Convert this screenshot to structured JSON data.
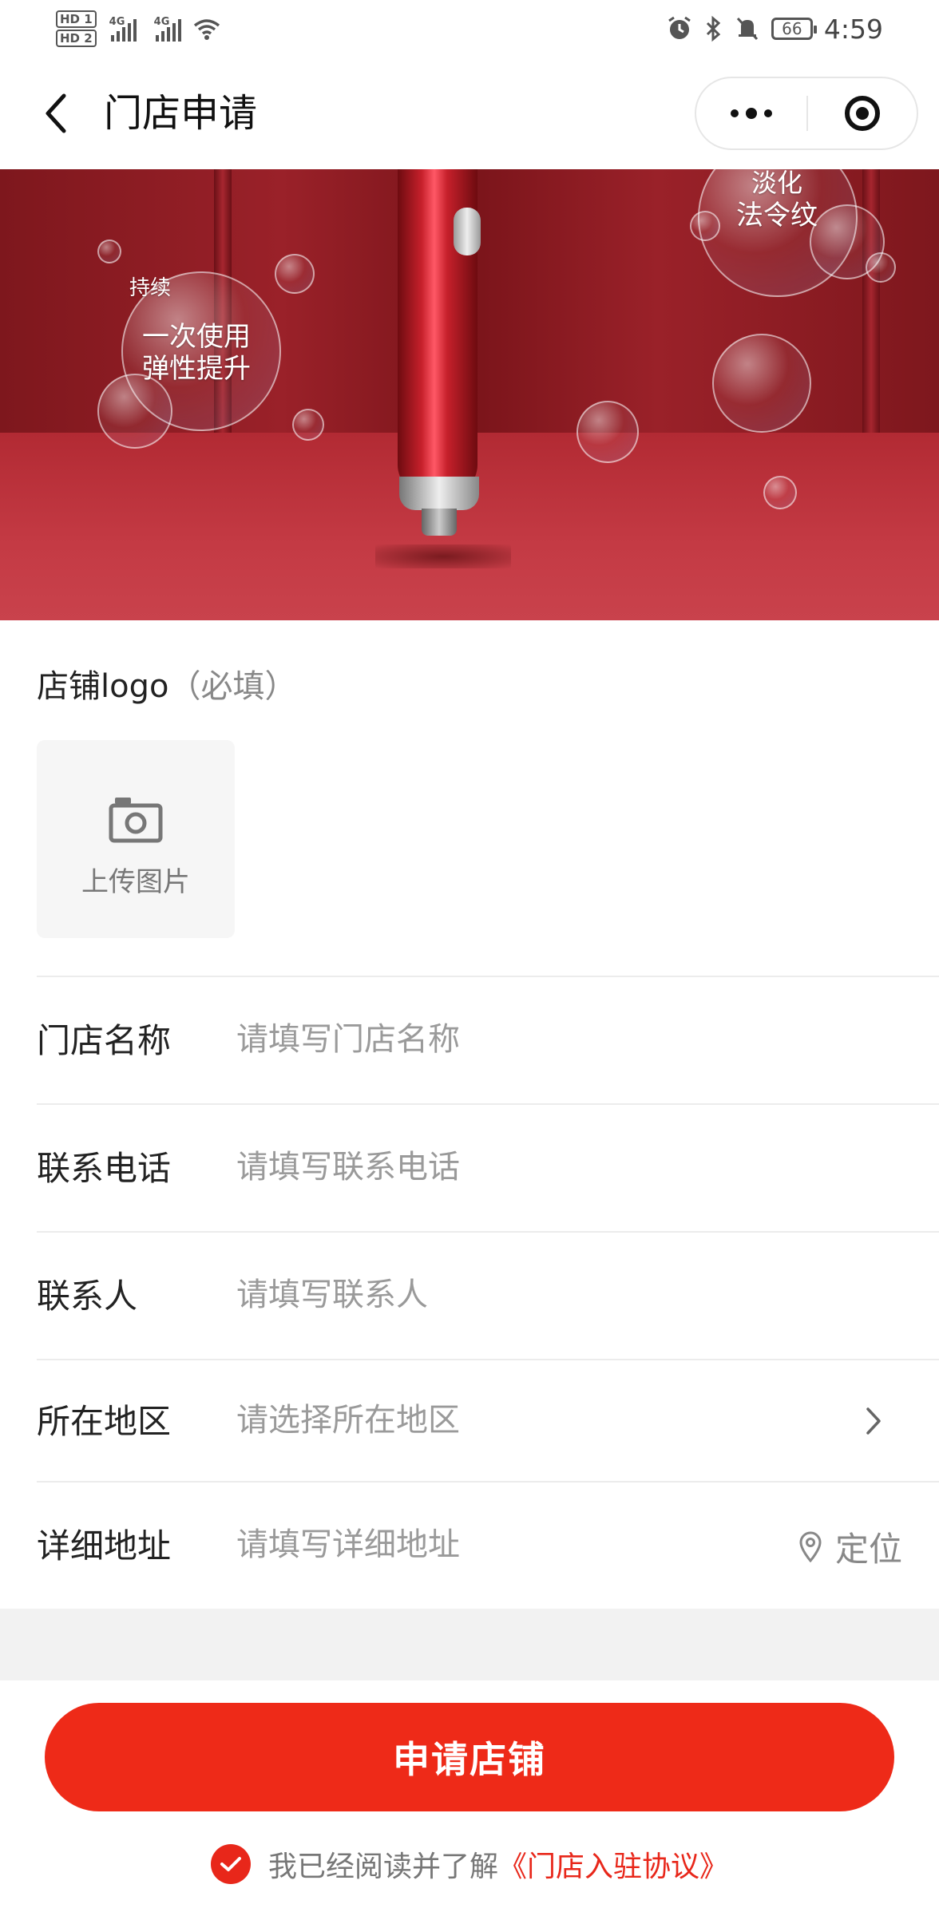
{
  "status_bar": {
    "sim1": "HD 1",
    "sim2": "HD 2",
    "network1": "4G",
    "network2": "4G",
    "battery": "66",
    "time": "4:59",
    "icons": [
      "alarm-icon",
      "bluetooth-icon",
      "mute-icon",
      "battery-icon"
    ]
  },
  "nav": {
    "title": "门店申请",
    "back_icon": "chevron-left-icon",
    "more_icon": "more-dots-icon",
    "close_icon": "target-icon"
  },
  "banner": {
    "bubble1_title": "持续",
    "bubble1_line1": "一次使用",
    "bubble1_line2": "弹性提升",
    "bubble2_line1": "淡化",
    "bubble2_line2": "法令纹"
  },
  "form": {
    "logo_label": "店铺logo",
    "logo_required": "（必填）",
    "upload_text": "上传图片",
    "fields": [
      {
        "label": "门店名称",
        "placeholder": "请填写门店名称",
        "value": ""
      },
      {
        "label": "联系电话",
        "placeholder": "请填写联系电话",
        "value": ""
      },
      {
        "label": "联系人",
        "placeholder": "请填写联系人",
        "value": ""
      },
      {
        "label": "所在地区",
        "placeholder": "请选择所在地区",
        "value": ""
      },
      {
        "label": "详细地址",
        "placeholder": "请填写详细地址",
        "value": ""
      }
    ],
    "locate_label": "定位"
  },
  "footer": {
    "submit_label": "申请店铺",
    "agree_text": "我已经阅读并了解",
    "agree_link": "《门店入驻协议》",
    "agree_checked": true
  },
  "colors": {
    "accent": "#ee2a18",
    "placeholder": "#9a9a9a"
  }
}
